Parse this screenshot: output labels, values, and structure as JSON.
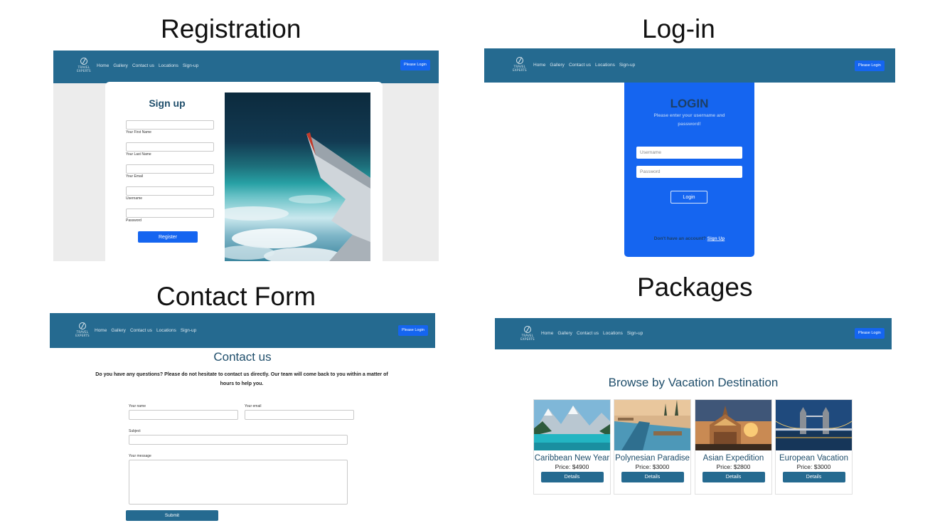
{
  "headings": {
    "registration": "Registration",
    "login": "Log-in",
    "contact": "Contact Form",
    "packages": "Packages"
  },
  "nav": {
    "logo_icon": "travel-experts-logo",
    "logo_text": "TRAVEL EXPERTS",
    "links": [
      "Home",
      "Gallery",
      "Contact us",
      "Locations",
      "Sign-up"
    ],
    "login_button": "Please Login",
    "bar_color": "#256a90",
    "button_color": "#1565f0"
  },
  "registration": {
    "title": "Sign up",
    "fields": [
      "Your First Name",
      "Your Last Name",
      "Your Email",
      "Username",
      "Password"
    ],
    "submit": "Register",
    "photo": "airplane-wing-over-clouds-photo"
  },
  "login": {
    "title": "LOGIN",
    "subtitle": "Please enter your username and password!",
    "username_placeholder": "Username",
    "password_placeholder": "Password",
    "submit": "Login",
    "no_account": "Don't have an account?",
    "signup_link": "Sign Up",
    "card_color": "#1565f0"
  },
  "contact": {
    "title": "Contact us",
    "intro": "Do you have any questions? Please do not hesitate to contact us directly. Our team will come back to you within a matter of hours to help you.",
    "name_label": "Your name",
    "email_label": "Your email",
    "subject_label": "Subject",
    "message_label": "Your message",
    "submit": "Submit"
  },
  "packages": {
    "title": "Browse by Vacation Destination",
    "items": [
      {
        "name": "Caribbean New Year",
        "price": "Price: $4900",
        "button": "Details",
        "image": "mountain-lake-photo"
      },
      {
        "name": "Polynesian Paradise",
        "price": "Price: $3000",
        "button": "Details",
        "image": "resort-pool-photo"
      },
      {
        "name": "Asian Expedition",
        "price": "Price: $2800",
        "button": "Details",
        "image": "thai-temple-sunset-photo"
      },
      {
        "name": "European Vacation",
        "price": "Price: $3000",
        "button": "Details",
        "image": "tower-bridge-night-photo"
      }
    ]
  }
}
